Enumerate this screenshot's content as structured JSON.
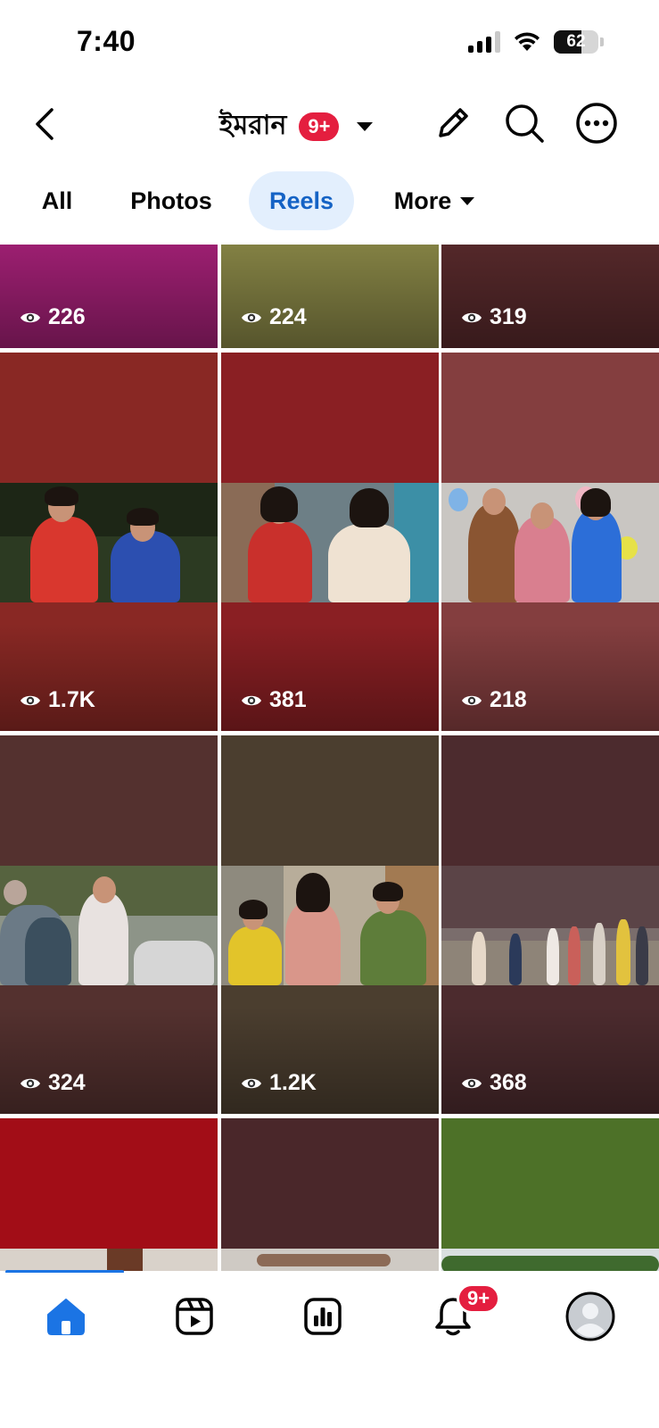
{
  "status_bar": {
    "time": "7:40",
    "battery": "62",
    "icons": [
      "signal-icon",
      "wifi-icon",
      "battery-icon"
    ]
  },
  "header": {
    "title": "ইমরান",
    "notification_badge": "9+",
    "icons": [
      "back-arrow-icon",
      "chevron-down-icon",
      "pencil-icon",
      "search-icon",
      "more-icon"
    ]
  },
  "tabs": [
    {
      "label": "All",
      "active": false
    },
    {
      "label": "Photos",
      "active": false
    },
    {
      "label": "Reels",
      "active": true
    },
    {
      "label": "More",
      "active": false
    }
  ],
  "reels": [
    {
      "views": "226",
      "color": "#9e1f72"
    },
    {
      "views": "224",
      "color": "#848244"
    },
    {
      "views": "319",
      "color": "#55282a"
    },
    {
      "views": "1.7K",
      "color": "#892824"
    },
    {
      "views": "381",
      "color": "#8a1f23"
    },
    {
      "views": "218",
      "color": "#843e3f"
    },
    {
      "views": "324",
      "color": "#54312f"
    },
    {
      "views": "1.2K",
      "color": "#4b3e2f"
    },
    {
      "views": "368",
      "color": "#4c2b2e"
    },
    {
      "views": "",
      "color": "#a20d17"
    },
    {
      "views": "",
      "color": "#4a272a"
    },
    {
      "views": "",
      "color": "#4d7128"
    }
  ],
  "bottom_nav": {
    "items": [
      "home-icon",
      "reels-icon",
      "dashboard-icon",
      "bell-icon",
      "profile-avatar"
    ],
    "notification_badge": "9+",
    "accent": "#1b74e4"
  },
  "colors": {
    "badge_red": "#e41e3f",
    "tab_active_bg": "#e3effd",
    "tab_active_text": "#1563c5"
  }
}
